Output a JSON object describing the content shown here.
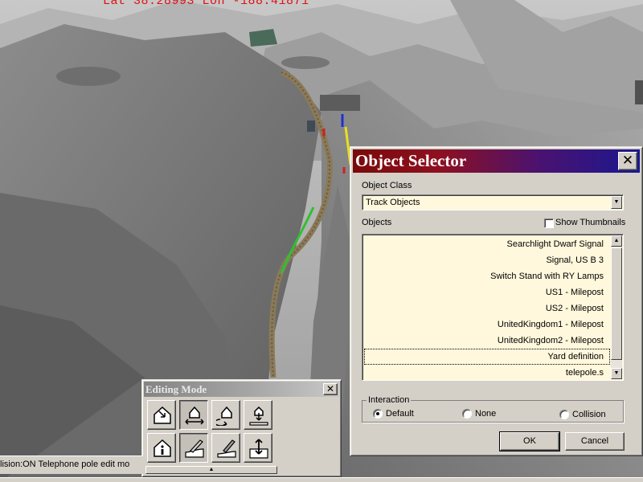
{
  "viewport": {
    "coord_readout": "Lat 38.28993 Lon -188.41871",
    "track_colors": {
      "rail": "#8a7a5a",
      "selected": "#30c030",
      "marker_yellow": "#e8e020",
      "marker_blue": "#2030d0",
      "marker_red": "#d02020"
    }
  },
  "object_selector": {
    "title": "Object Selector",
    "close_glyph": "✕",
    "object_class_label": "Object Class",
    "object_class_value": "Track Objects",
    "objects_label": "Objects",
    "show_thumbnails_label": "Show Thumbnails",
    "show_thumbnails_checked": false,
    "objects": [
      "Searchlight Dwarf Signal",
      "Signal, US B 3",
      "Switch Stand with RY Lamps",
      "US1 - Milepost",
      "US2 - Milepost",
      "UnitedKingdom1 - Milepost",
      "UnitedKingdom2 - Milepost",
      "Yard definition",
      "telepole.s"
    ],
    "selected_object": "Yard definition",
    "interaction": {
      "label": "Interaction",
      "options": [
        "Default",
        "None",
        "Collision"
      ],
      "selected": "Default"
    },
    "ok_label": "OK",
    "cancel_label": "Cancel"
  },
  "editing_mode": {
    "title": "Editing Mode",
    "close_glyph": "✕",
    "tools": [
      "select-object-icon",
      "move-object-icon",
      "rotate-object-icon",
      "elevate-object-icon",
      "object-info-icon",
      "terrain-edit-icon",
      "terrain-paint-icon",
      "raise-lower-terrain-icon"
    ],
    "pressed_tools": [
      "move-object-icon",
      "terrain-edit-icon"
    ]
  },
  "status_bar": {
    "text": "lision:ON Telephone pole edit mo"
  }
}
